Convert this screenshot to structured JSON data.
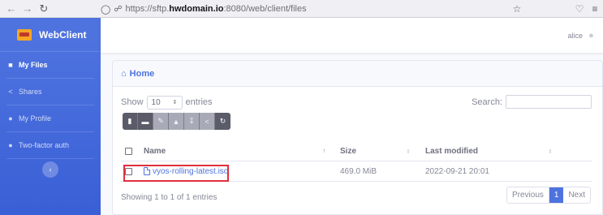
{
  "browser": {
    "url_prefix": "https://sftp.",
    "url_host": "hwdomain.io",
    "url_suffix": ":8080/web/client/files"
  },
  "brand": {
    "title": "WebClient"
  },
  "sidebar": {
    "items": [
      {
        "label": "My Files",
        "icon": "folder-icon",
        "active": true
      },
      {
        "label": "Shares",
        "icon": "share-icon",
        "active": false
      },
      {
        "label": "My Profile",
        "icon": "user-icon",
        "active": false
      },
      {
        "label": "Two-factor auth",
        "icon": "users-icon",
        "active": false
      }
    ]
  },
  "topbar": {
    "username": "alice"
  },
  "card": {
    "title": "Home",
    "show_label": "Show",
    "entries_value": "10",
    "entries_label": "entries",
    "search_label": "Search:",
    "search_value": ""
  },
  "toolbar": {
    "buttons": [
      "new-file",
      "new-folder",
      "rename",
      "delete",
      "download",
      "share",
      "refresh"
    ]
  },
  "table": {
    "headers": {
      "name": "Name",
      "size": "Size",
      "modified": "Last modified"
    },
    "rows": [
      {
        "name": "vyos-rolling-latest.iso",
        "size": "469.0 MiB",
        "modified": "2022-09-21 20:01"
      }
    ]
  },
  "footer": {
    "info": "Showing 1 to 1 of 1 entries",
    "previous": "Previous",
    "page": "1",
    "next": "Next"
  },
  "colors": {
    "primary": "#4e73df",
    "highlight": "#e0303c"
  }
}
